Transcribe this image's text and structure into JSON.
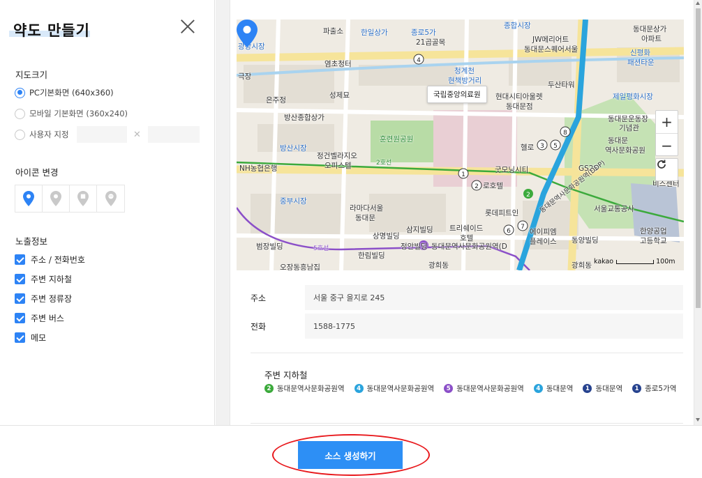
{
  "panel": {
    "title": "약도 만들기",
    "map_size": {
      "label": "지도크기",
      "options": [
        {
          "label": "PC기본화면 (640x360)",
          "selected": true
        },
        {
          "label": "모바일 기본화면 (360x240)",
          "selected": false
        },
        {
          "label": "사용자 지정",
          "selected": false
        }
      ],
      "custom_width_value": "",
      "custom_height_value": ""
    },
    "icon_change": {
      "label": "아이콘 변경",
      "selected_index": 0,
      "icons": [
        "pin-filled-icon",
        "pin-outline-icon",
        "pin-square-icon",
        "pin-face-icon"
      ]
    },
    "exposure": {
      "label": "노출정보",
      "items": [
        {
          "label": "주소 / 전화번호",
          "checked": true
        },
        {
          "label": "주변 지하철",
          "checked": true
        },
        {
          "label": "주변 정류장",
          "checked": true
        },
        {
          "label": "주변 버스",
          "checked": true
        },
        {
          "label": "메모",
          "checked": true
        }
      ]
    }
  },
  "map": {
    "popup_label": "국립중앙의료원",
    "copyright": "kakao",
    "scale_label": "100m",
    "labels": [
      {
        "text": "광장시장",
        "color": "blue"
      },
      {
        "text": "한일상가",
        "color": "blue"
      },
      {
        "text": "종로5가",
        "color": "blue"
      },
      {
        "text": "파출소",
        "color": "dark"
      },
      {
        "text": "21곱골목",
        "color": "dark"
      },
      {
        "text": "종합시장",
        "color": "blue"
      },
      {
        "text": "JW메리어트",
        "color": "dark"
      },
      {
        "text": "동대문스퀘어서울",
        "color": "dark"
      },
      {
        "text": "동대문상가",
        "color": "dark"
      },
      {
        "text": "아파트",
        "color": "dark"
      },
      {
        "text": "신평화",
        "color": "blue"
      },
      {
        "text": "패션타운",
        "color": "blue"
      },
      {
        "text": "청계천",
        "color": "blue"
      },
      {
        "text": "현책방거리",
        "color": "blue"
      },
      {
        "text": "염초청터",
        "color": "dark"
      },
      {
        "text": "극장",
        "color": "dark"
      },
      {
        "text": "성제묘",
        "color": "dark"
      },
      {
        "text": "현대시티아울렛",
        "color": "dark"
      },
      {
        "text": "동대문점",
        "color": "dark"
      },
      {
        "text": "두산타워",
        "color": "dark"
      },
      {
        "text": "제일평화시장",
        "color": "blue"
      },
      {
        "text": "은주정",
        "color": "dark"
      },
      {
        "text": "방산종합상가",
        "color": "dark"
      },
      {
        "text": "동대문운동장",
        "color": "dark"
      },
      {
        "text": "기념관",
        "color": "dark"
      },
      {
        "text": "방산시장",
        "color": "blue"
      },
      {
        "text": "훈련원공원",
        "color": "green"
      },
      {
        "text": "정건벨라지오",
        "color": "dark"
      },
      {
        "text": "오피스텔",
        "color": "dark"
      },
      {
        "text": "헬로",
        "color": "dark"
      },
      {
        "text": "동대문",
        "color": "dark"
      },
      {
        "text": "역사문화공원",
        "color": "dark"
      },
      {
        "text": "NH농협은행",
        "color": "dark"
      },
      {
        "text": "굿모닝시티",
        "color": "dark"
      },
      {
        "text": "GS25",
        "color": "dark"
      },
      {
        "text": "로호텔",
        "color": "dark"
      },
      {
        "text": "비스센터",
        "color": "dark"
      },
      {
        "text": "중부시장",
        "color": "blue"
      },
      {
        "text": "라마다서울",
        "color": "dark"
      },
      {
        "text": "동대문",
        "color": "dark"
      },
      {
        "text": "롯데피트인",
        "color": "dark"
      },
      {
        "text": "서울교통공사",
        "color": "dark"
      },
      {
        "text": "삼지빌딩",
        "color": "dark"
      },
      {
        "text": "트리쉐이드",
        "color": "dark"
      },
      {
        "text": "호텔",
        "color": "dark"
      },
      {
        "text": "에이피엠",
        "color": "dark"
      },
      {
        "text": "플레이스",
        "color": "dark"
      },
      {
        "text": "한양공업",
        "color": "dark"
      },
      {
        "text": "고등학교",
        "color": "dark"
      },
      {
        "text": "상명빌딩",
        "color": "dark"
      },
      {
        "text": "동양빌딩",
        "color": "dark"
      },
      {
        "text": "범장빌딩",
        "color": "dark"
      },
      {
        "text": "정안빌딩",
        "color": "dark"
      },
      {
        "text": "한림빌딩",
        "color": "dark"
      },
      {
        "text": "오장동흥남집",
        "color": "dark"
      },
      {
        "text": "광희동",
        "color": "dark"
      },
      {
        "text": "광희동",
        "color": "dark"
      },
      {
        "text": "동대문역사문화공원역(D",
        "color": "dark"
      },
      {
        "text": "동대문역사문화공원역(DDP)",
        "color": "dark"
      },
      {
        "text": "2호선",
        "color": "green"
      },
      {
        "text": "5호선",
        "color": "purple"
      }
    ]
  },
  "info": {
    "address_label": "주소",
    "address_value": "서울 중구 을지로 245",
    "phone_label": "전화",
    "phone_value": "1588-1775",
    "subway_title": "주변 지하철",
    "subway_stations": [
      {
        "line": "2",
        "color": "#3caa3c",
        "name": "동대문역사문화공원역"
      },
      {
        "line": "4",
        "color": "#2aa4dd",
        "name": "동대문역사문화공원역"
      },
      {
        "line": "5",
        "color": "#8b4fc8",
        "name": "동대문역사문화공원역"
      },
      {
        "line": "4",
        "color": "#2aa4dd",
        "name": "동대문역"
      },
      {
        "line": "1",
        "color": "#27438f",
        "name": "동대문역"
      },
      {
        "line": "1",
        "color": "#27438f",
        "name": "종로5가역"
      }
    ]
  },
  "footer": {
    "generate_label": "소스 생성하기",
    "highlight_color": "#e8191d"
  }
}
